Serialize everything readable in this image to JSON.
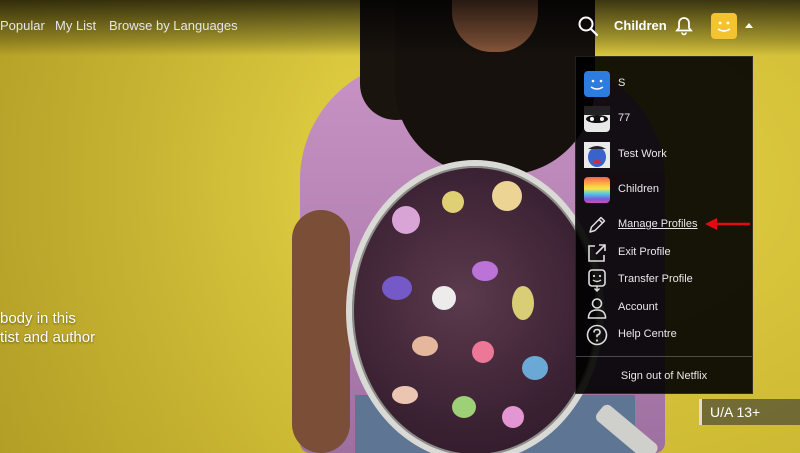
{
  "nav": {
    "links": [
      "Popular",
      "My List",
      "Browse by Languages"
    ],
    "kids_label": "Children",
    "icons": {
      "search": "search-icon",
      "bell": "bell-icon",
      "profile": "profile-avatar"
    }
  },
  "hero": {
    "synopsis_line1": "body in this",
    "synopsis_line2": "tist and author",
    "maturity_rating": "U/A 13+"
  },
  "dropdown": {
    "profiles": [
      {
        "name": "S",
        "avatar": "blue-smiley",
        "color": "#2d7de0"
      },
      {
        "name": "77",
        "avatar": "masked-face",
        "color": "#e8e8e8"
      },
      {
        "name": "Test Work",
        "avatar": "blue-cartoon",
        "color": "#3a63c9"
      },
      {
        "name": "Children",
        "avatar": "kids-rainbow",
        "color": "#d44bb5"
      }
    ],
    "actions": [
      {
        "label": "Manage Profiles",
        "icon": "pencil-icon"
      },
      {
        "label": "Exit Profile",
        "icon": "exit-icon"
      },
      {
        "label": "Transfer Profile",
        "icon": "transfer-icon"
      },
      {
        "label": "Account",
        "icon": "person-icon"
      },
      {
        "label": "Help Centre",
        "icon": "help-icon"
      }
    ],
    "sign_out": "Sign out of Netflix"
  },
  "colors": {
    "accent_arrow": "#e50914",
    "profile_yellow": "#f4c430"
  }
}
